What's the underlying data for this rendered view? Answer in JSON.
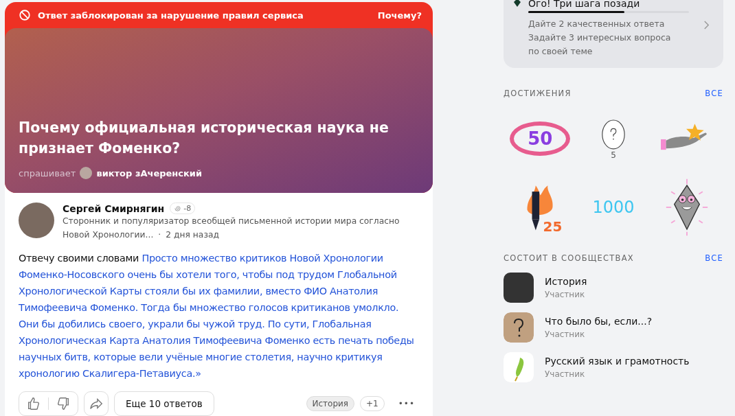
{
  "question_card": {
    "blocked_notice": "Ответ заблокирован за нарушение правил сервиса",
    "why_link": "Почему?",
    "title": "Почему официальная историческая наука не признает Фоменко?",
    "asked_label": "спрашивает",
    "asker": "виктор зАчеренский"
  },
  "answer": {
    "author": "Сергей Смирнягин",
    "rating": "-8",
    "bio_line1": "Сторонник и популяризатор всеобщей письменной истории мира согласно",
    "bio_line2": "Новой Хронологии...",
    "separator": "·",
    "time": "2 дня назад",
    "intro": "Отвечу своими словами ",
    "quote": "Просто множество критиков Новой Хронологии Фоменко-Носовского очень бы хотели того, чтобы под трудом Глобальной Хронологической Карты стояли бы их фамилии, вместо ФИО Анатолия Тимофеевича Фоменко. Тогда бы множество голосов критиканов умолкло. Они бы добились своего, украли бы чужой труд. По сути, Глобальная Хронологическая Карта Анатолия Тимофеевича Фоменко есть печать победы научных битв, которые вели учёные многие столетия, научно критикуя хронологию Скалигера-Петавиуса.»",
    "more_answers": "Еще 10 ответов",
    "tags": [
      "История",
      "+1"
    ],
    "more": "•••"
  },
  "progress_card": {
    "title": "Ого! Три шага позади",
    "level": 0.6,
    "tasks": [
      "Дайте 2 качественных ответа",
      "Задайте 3 интересных вопроса по своей теме"
    ]
  },
  "achievements": {
    "heading": "ДОСТИЖЕНИЯ",
    "all_link": "ВСЕ",
    "badges": [
      {
        "kind": "thumbs",
        "label": "50"
      },
      {
        "kind": "egg",
        "count": "5"
      },
      {
        "kind": "hand"
      },
      {
        "kind": "pencil",
        "label": "25"
      },
      {
        "kind": "number",
        "label": "1000"
      },
      {
        "kind": "crystal"
      }
    ]
  },
  "communities": {
    "heading": "СОСТОИТ В СООБЩЕСТВАХ",
    "all_link": "ВСЕ",
    "items": [
      {
        "kind": "photo",
        "name": "История",
        "role": "Участник"
      },
      {
        "kind": "question",
        "name": "Что было бы, если...?",
        "role": "Участник"
      },
      {
        "kind": "leaf",
        "name": "Русский язык и грамотность",
        "role": "Участник"
      }
    ]
  }
}
